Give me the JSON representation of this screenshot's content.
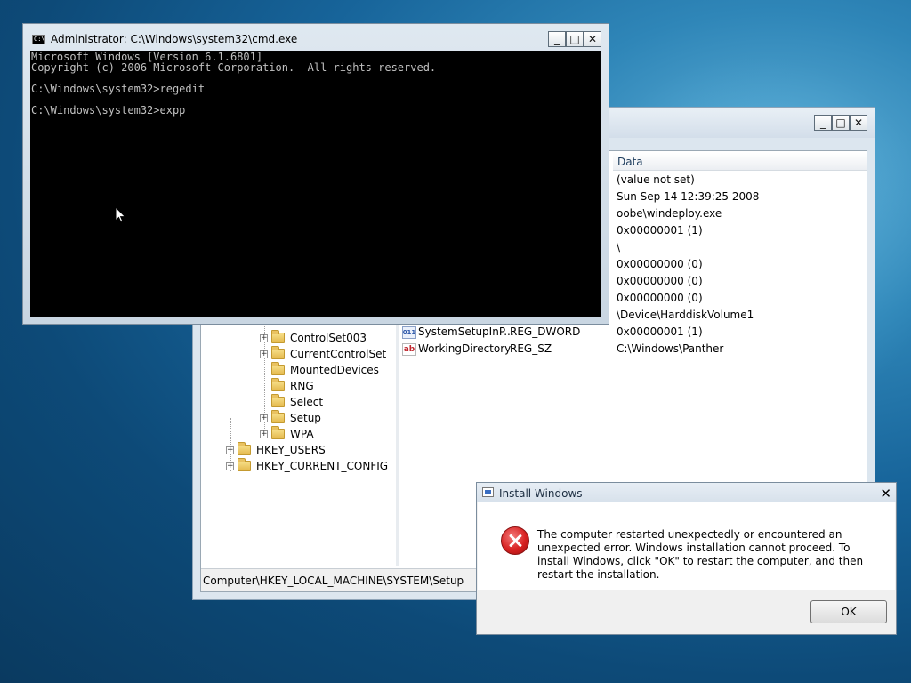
{
  "cmd": {
    "title": "Administrator: C:\\Windows\\system32\\cmd.exe",
    "icon": "cmd-icon",
    "lines": [
      "Microsoft Windows [Version 6.1.6801]",
      "Copyright (c) 2006 Microsoft Corporation.  All rights reserved.",
      "",
      "C:\\Windows\\system32>regedit",
      "",
      "C:\\Windows\\system32>expp"
    ],
    "caption_buttons": {
      "minimize": "_",
      "maximize": "□",
      "close": "✕"
    }
  },
  "regedit": {
    "caption_buttons": {
      "minimize": "_",
      "maximize": "□",
      "close": "✕"
    },
    "columns": {
      "data": "Data"
    },
    "rows": [
      {
        "data": "(value not set)"
      },
      {
        "data": "Sun Sep 14 12:39:25 2008"
      },
      {
        "data": "oobe\\windeploy.exe"
      },
      {
        "data": "0x00000001 (1)"
      },
      {
        "data": "\\"
      },
      {
        "data": "0x00000000 (0)"
      },
      {
        "data": "0x00000000 (0)"
      },
      {
        "data": "0x00000000 (0)"
      },
      {
        "data": "\\Device\\HarddiskVolume1"
      },
      {
        "name": "SystemSetupInP...",
        "type": "REG_DWORD",
        "data": "0x00000001 (1)",
        "icon": "dword"
      },
      {
        "name": "WorkingDirectory",
        "type": "REG_SZ",
        "data": "C:\\Windows\\Panther",
        "icon": "sz"
      }
    ],
    "tree": [
      {
        "label": "ControlSet003",
        "expander": "+"
      },
      {
        "label": "CurrentControlSet",
        "expander": "+"
      },
      {
        "label": "MountedDevices",
        "expander": ""
      },
      {
        "label": "RNG",
        "expander": ""
      },
      {
        "label": "Select",
        "expander": ""
      },
      {
        "label": "Setup",
        "expander": "+"
      },
      {
        "label": "WPA",
        "expander": "+"
      },
      {
        "label": "HKEY_USERS",
        "expander": "+"
      },
      {
        "label": "HKEY_CURRENT_CONFIG",
        "expander": "+"
      }
    ],
    "status": "Computer\\HKEY_LOCAL_MACHINE\\SYSTEM\\Setup"
  },
  "dialog": {
    "title": "Install Windows",
    "close": "✕",
    "message": "The computer restarted unexpectedly or encountered an unexpected error. Windows installation cannot proceed. To install Windows, click \"OK\" to restart the computer, and then restart the installation.",
    "ok_label": "OK",
    "icon": "error-icon"
  }
}
